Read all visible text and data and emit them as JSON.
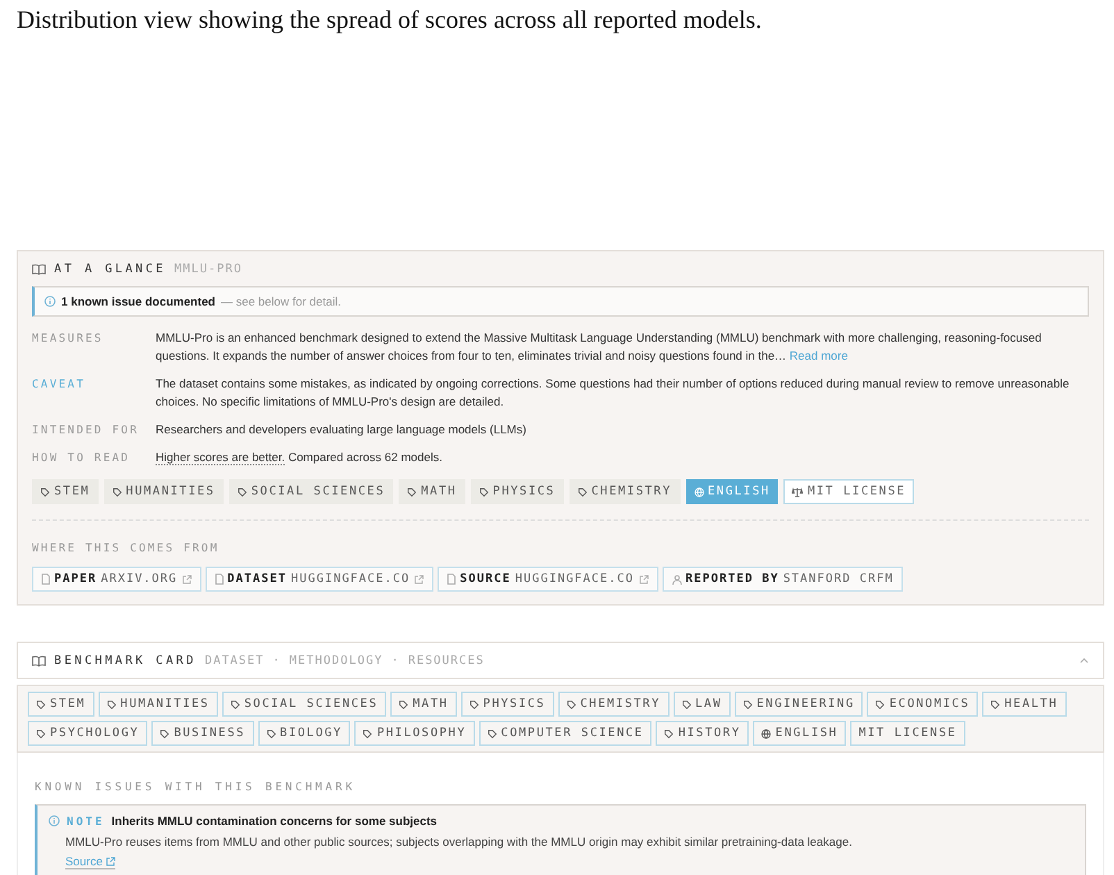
{
  "caption": "Distribution view showing the spread of scores across all reported models.",
  "glance": {
    "title": "AT A GLANCE",
    "subtitle": "MMLU-PRO",
    "issue_banner": {
      "count_text": "1 known issue documented",
      "rest": " — see below for detail."
    },
    "facts": [
      {
        "label": "MEASURES",
        "kind": "plain",
        "text": "MMLU-Pro is an enhanced benchmark designed to extend the Massive Multitask Language Understanding (MMLU) benchmark with more challenging, reasoning-focused questions. It expands the number of answer choices from four to ten, eliminates trivial and noisy questions found in the…",
        "link": "Read more"
      },
      {
        "label": "CAVEAT",
        "kind": "caveat",
        "text": "The dataset contains some mistakes, as indicated by ongoing corrections. Some questions had their number of options reduced during manual review to remove unreasonable choices. No specific limitations of MMLU-Pro's design are detailed."
      },
      {
        "label": "INTENDED FOR",
        "kind": "plain",
        "text": "Researchers and developers evaluating large language models (LLMs)"
      },
      {
        "label": "HOW TO READ",
        "kind": "read",
        "underlined": "Higher scores are better.",
        "text": " Compared across 62 models."
      }
    ],
    "tags": [
      {
        "label": "STEM",
        "kind": "tag"
      },
      {
        "label": "HUMANITIES",
        "kind": "tag"
      },
      {
        "label": "SOCIAL SCIENCES",
        "kind": "tag"
      },
      {
        "label": "MATH",
        "kind": "tag"
      },
      {
        "label": "PHYSICS",
        "kind": "tag"
      },
      {
        "label": "CHEMISTRY",
        "kind": "tag"
      },
      {
        "label": "ENGLISH",
        "kind": "language"
      },
      {
        "label": "MIT LICENSE",
        "kind": "license"
      }
    ],
    "sources_title": "WHERE THIS COMES FROM",
    "sources": [
      {
        "kind": "document",
        "label": "PAPER",
        "value": "ARXIV.ORG",
        "external": true
      },
      {
        "kind": "document",
        "label": "DATASET",
        "value": "HUGGINGFACE.CO",
        "external": true
      },
      {
        "kind": "document",
        "label": "SOURCE",
        "value": "HUGGINGFACE.CO",
        "external": true
      },
      {
        "kind": "person",
        "label": "REPORTED BY",
        "value": "STANFORD CRFM",
        "external": false
      }
    ]
  },
  "card": {
    "title": "BENCHMARK CARD",
    "sections": [
      "DATASET",
      "METHODOLOGY",
      "RESOURCES"
    ],
    "separator": "·",
    "expanded": true,
    "tags": [
      {
        "label": "STEM",
        "kind": "tag"
      },
      {
        "label": "HUMANITIES",
        "kind": "tag"
      },
      {
        "label": "SOCIAL SCIENCES",
        "kind": "tag"
      },
      {
        "label": "MATH",
        "kind": "tag"
      },
      {
        "label": "PHYSICS",
        "kind": "tag"
      },
      {
        "label": "CHEMISTRY",
        "kind": "tag"
      },
      {
        "label": "LAW",
        "kind": "tag"
      },
      {
        "label": "ENGINEERING",
        "kind": "tag"
      },
      {
        "label": "ECONOMICS",
        "kind": "tag"
      },
      {
        "label": "HEALTH",
        "kind": "tag"
      },
      {
        "label": "PSYCHOLOGY",
        "kind": "tag"
      },
      {
        "label": "BUSINESS",
        "kind": "tag"
      },
      {
        "label": "BIOLOGY",
        "kind": "tag"
      },
      {
        "label": "PHILOSOPHY",
        "kind": "tag"
      },
      {
        "label": "COMPUTER SCIENCE",
        "kind": "tag"
      },
      {
        "label": "HISTORY",
        "kind": "tag"
      },
      {
        "label": "ENGLISH",
        "kind": "language"
      },
      {
        "label": "MIT LICENSE",
        "kind": "plain"
      }
    ],
    "issues_title": "KNOWN ISSUES WITH THIS BENCHMARK",
    "issues": [
      {
        "badge": "NOTE",
        "title": "Inherits MMLU contamination concerns for some subjects",
        "text": "MMLU-Pro reuses items from MMLU and other public sources; subjects overlapping with the MMLU origin may exhibit similar pretraining-data leakage.",
        "link": "Source"
      }
    ]
  }
}
